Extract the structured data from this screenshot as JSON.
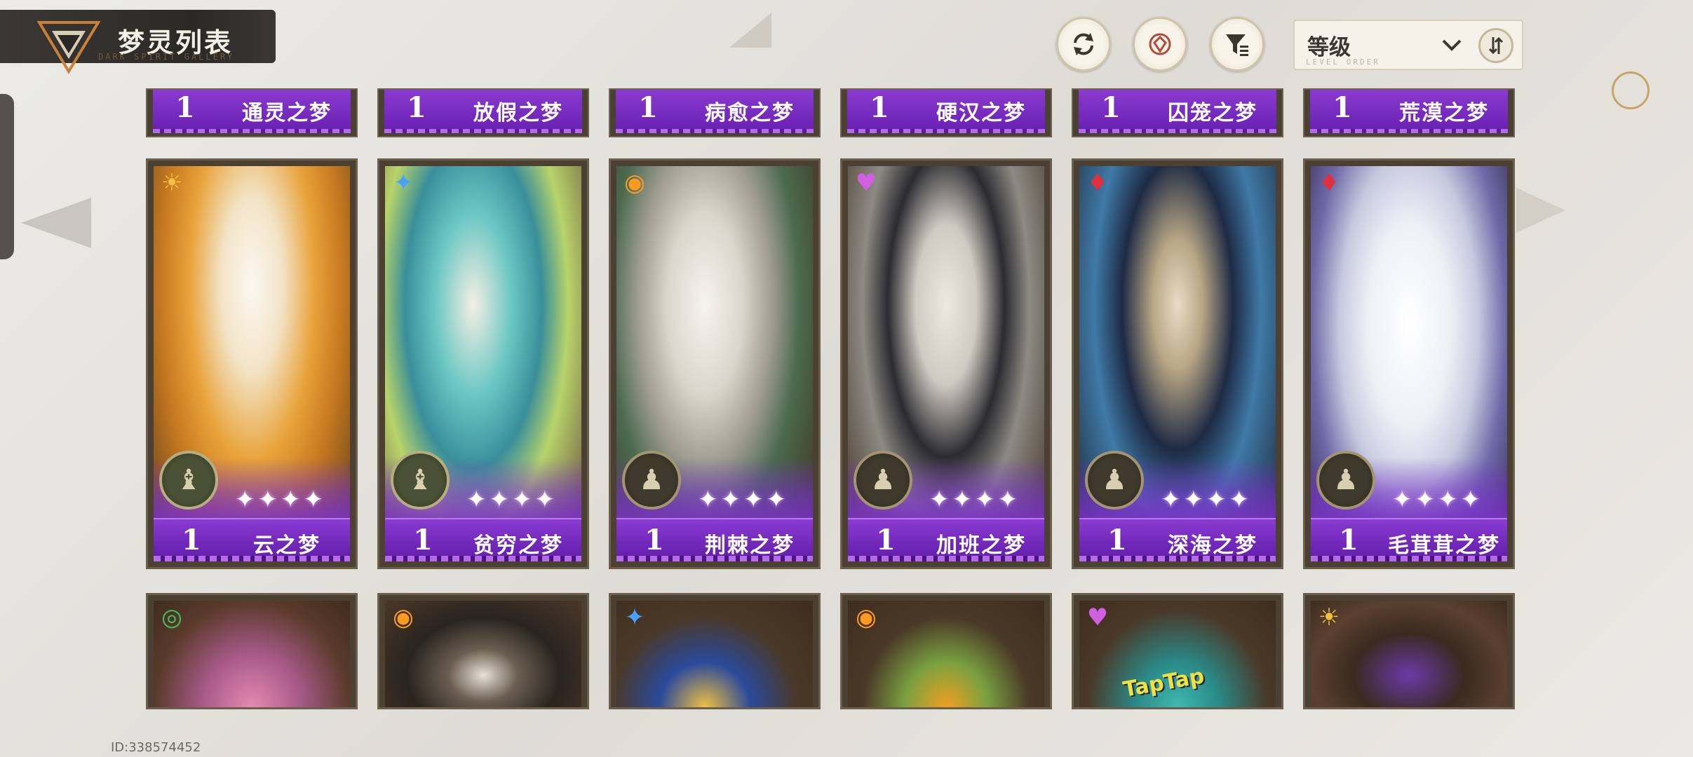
{
  "header": {
    "title": "梦灵列表",
    "subtitle": "DARK SPIRIT GALLERY"
  },
  "controls": {
    "refresh_icon": "refresh-icon",
    "target_icon": "target-icon",
    "filter_icon": "filter-icon",
    "sort_label": "等级",
    "sort_sub": "LEVEL ORDER"
  },
  "top_row": [
    {
      "level": "1",
      "name": "通灵之梦"
    },
    {
      "level": "1",
      "name": "放假之梦"
    },
    {
      "level": "1",
      "name": "病愈之梦"
    },
    {
      "level": "1",
      "name": "硬汉之梦"
    },
    {
      "level": "1",
      "name": "囚笼之梦"
    },
    {
      "level": "1",
      "name": "荒漠之梦"
    }
  ],
  "cards": [
    {
      "level": "1",
      "name": "云之梦",
      "stars": "✦✦✦✦",
      "element": "☀",
      "element_color": "#f0c040",
      "rank": "♝"
    },
    {
      "level": "1",
      "name": "贫穷之梦",
      "stars": "✦✦✦✦",
      "element": "✦",
      "element_color": "#4aa0ff",
      "rank": "♝"
    },
    {
      "level": "1",
      "name": "荆棘之梦",
      "stars": "✦✦✦✦",
      "element": "◉",
      "element_color": "#ff9a20",
      "rank": "♟"
    },
    {
      "level": "1",
      "name": "加班之梦",
      "stars": "✦✦✦✦",
      "element": "♥",
      "element_color": "#d060e0",
      "rank": "♟"
    },
    {
      "level": "1",
      "name": "深海之梦",
      "stars": "✦✦✦✦",
      "element": "♦",
      "element_color": "#e03040",
      "rank": "♟"
    },
    {
      "level": "1",
      "name": "毛茸茸之梦",
      "stars": "✦✦✦✦",
      "element": "♦",
      "element_color": "#e03040",
      "rank": "♟"
    }
  ],
  "bottom_row": [
    {
      "element": "◎",
      "element_color": "#40c060"
    },
    {
      "element": "◉",
      "element_color": "#ff9a20"
    },
    {
      "element": "✦",
      "element_color": "#4aa0ff"
    },
    {
      "element": "◉",
      "element_color": "#ff9a20"
    },
    {
      "element": "♥",
      "element_color": "#d060e0"
    },
    {
      "element": "☀",
      "element_color": "#f0c040"
    }
  ],
  "bottom_art_text": "TapTap",
  "footer": {
    "id_text": "ID:338574452"
  }
}
